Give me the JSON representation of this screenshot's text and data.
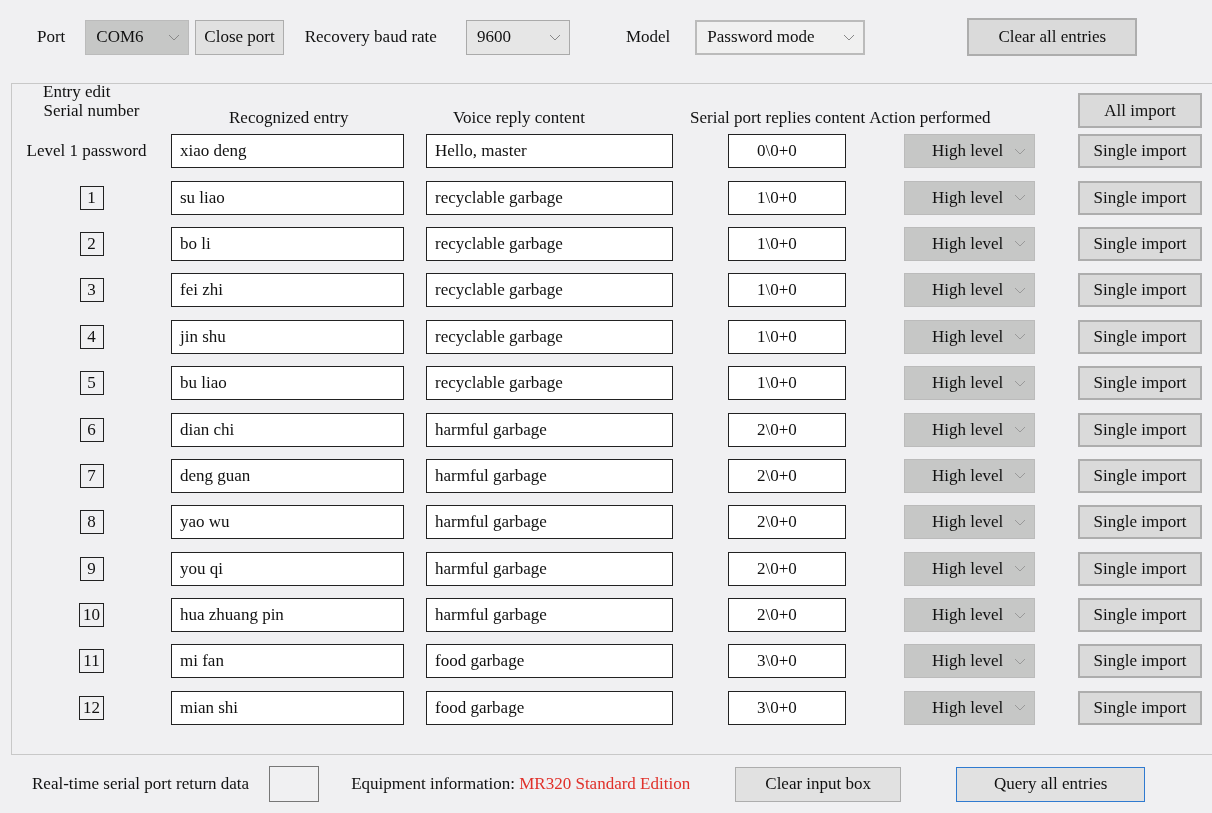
{
  "toolbar": {
    "port_label": "Port",
    "port": {
      "value": "COM6",
      "disabled": true
    },
    "close_port": "Close port",
    "baud_label": "Recovery baud rate",
    "baud": {
      "value": "9600",
      "disabled": false
    },
    "model_label": "Model",
    "model": "Password mode",
    "clear_all": "Clear all entries"
  },
  "entry_edit": {
    "title": "Entry edit",
    "headers": [
      "Serial number",
      "Recognized entry",
      "Voice reply content",
      "Serial port replies content",
      "Action performed"
    ],
    "all_import": "All import",
    "rows": [
      {
        "kind": "label",
        "serial": "Level 1 password",
        "entry": "xiao deng",
        "reply": "Hello, master",
        "port_reply": "0\\0+0",
        "action": "High level",
        "action_disabled": true,
        "button": "Single import"
      },
      {
        "kind": "number",
        "serial": "1",
        "entry": "su liao",
        "reply": "recyclable garbage",
        "port_reply": "1\\0+0",
        "action": "High level",
        "action_disabled": true,
        "button": "Single import"
      },
      {
        "kind": "number",
        "serial": "2",
        "entry": "bo li",
        "reply": "recyclable garbage",
        "port_reply": "1\\0+0",
        "action": "High level",
        "action_disabled": true,
        "button": "Single import"
      },
      {
        "kind": "number",
        "serial": "3",
        "entry": "fei zhi",
        "reply": "recyclable garbage",
        "port_reply": "1\\0+0",
        "action": "High level",
        "action_disabled": true,
        "button": "Single import"
      },
      {
        "kind": "number",
        "serial": "4",
        "entry": "jin shu",
        "reply": "recyclable garbage",
        "port_reply": "1\\0+0",
        "action": "High level",
        "action_disabled": true,
        "button": "Single import"
      },
      {
        "kind": "number",
        "serial": "5",
        "entry": "bu liao",
        "reply": "recyclable garbage",
        "port_reply": "1\\0+0",
        "action": "High level",
        "action_disabled": true,
        "button": "Single import"
      },
      {
        "kind": "number",
        "serial": "6",
        "entry": "dian chi",
        "reply": "harmful garbage",
        "port_reply": "2\\0+0",
        "action": "High level",
        "action_disabled": true,
        "button": "Single import"
      },
      {
        "kind": "number",
        "serial": "7",
        "entry": "deng guan",
        "reply": "harmful garbage",
        "port_reply": "2\\0+0",
        "action": "High level",
        "action_disabled": true,
        "button": "Single import"
      },
      {
        "kind": "number",
        "serial": "8",
        "entry": "yao wu",
        "reply": "harmful garbage",
        "port_reply": "2\\0+0",
        "action": "High level",
        "action_disabled": true,
        "button": "Single import"
      },
      {
        "kind": "number",
        "serial": "9",
        "entry": "you qi",
        "reply": "harmful garbage",
        "port_reply": "2\\0+0",
        "action": "High level",
        "action_disabled": true,
        "button": "Single import"
      },
      {
        "kind": "number",
        "serial": "10",
        "entry": "hua zhuang pin",
        "reply": "harmful garbage",
        "port_reply": "2\\0+0",
        "action": "High level",
        "action_disabled": true,
        "button": "Single import"
      },
      {
        "kind": "number",
        "serial": "11",
        "entry": "mi fan",
        "reply": "food garbage",
        "port_reply": "3\\0+0",
        "action": "High level",
        "action_disabled": true,
        "button": "Single import"
      },
      {
        "kind": "number",
        "serial": "12",
        "entry": "mian shi",
        "reply": "food garbage",
        "port_reply": "3\\0+0",
        "action": "High level",
        "action_disabled": true,
        "button": "Single import"
      }
    ]
  },
  "footer": {
    "realtime_label": "Real-time serial port return data",
    "equipment_label": "Equipment information:",
    "equipment_value": "MR320 Standard Edition",
    "clear_input": "Clear input box",
    "query_all": "Query all entries"
  }
}
